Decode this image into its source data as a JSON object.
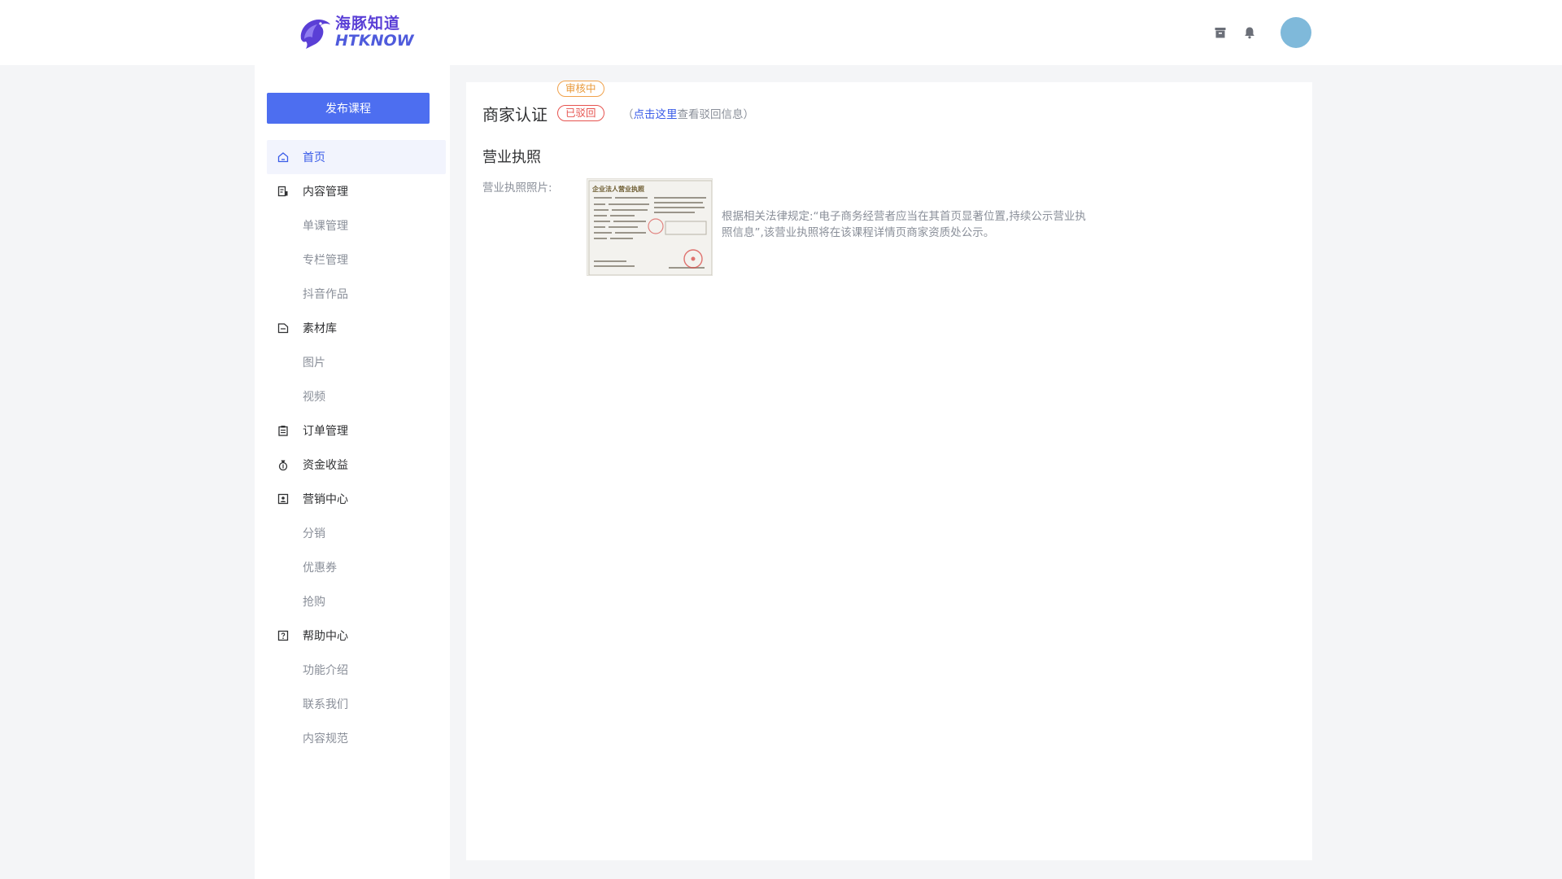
{
  "header": {
    "logo_cn": "海豚知道",
    "logo_en": "HTKNOW",
    "icons": [
      "archive-icon",
      "bell-icon"
    ],
    "avatar_color": "#7fb9da"
  },
  "sidebar": {
    "publish_label": "发布课程",
    "items": {
      "home": "首页",
      "content": "内容管理",
      "content_single": "单课管理",
      "content_column": "专栏管理",
      "content_douyin": "抖音作品",
      "material": "素材库",
      "material_image": "图片",
      "material_video": "视频",
      "orders": "订单管理",
      "funds": "资金收益",
      "marketing": "营销中心",
      "marketing_distribution": "分销",
      "marketing_coupon": "优惠券",
      "marketing_flash": "抢购",
      "help": "帮助中心",
      "help_features": "功能介绍",
      "help_contact": "联系我们",
      "help_rules": "内容规范"
    }
  },
  "main": {
    "title": "商家认证",
    "badge_pending": "审核中",
    "badge_rejected": "已驳回",
    "hint_open": "（",
    "hint_link": "点击这里",
    "hint_rest": "查看驳回信息）",
    "section_title": "营业执照",
    "field_label": "营业执照照片:",
    "note": "根据相关法律规定:“电子商务经营者应当在其首页显著位置,持续公示营业执照信息”,该营业执照将在该课程详情页商家资质处公示。",
    "license_title": "企业法人营业执照"
  },
  "colors": {
    "primary": "#4d6ef0",
    "active_text": "#3a5ce8",
    "pending": "#e99a3b",
    "rejected": "#e6534f"
  }
}
